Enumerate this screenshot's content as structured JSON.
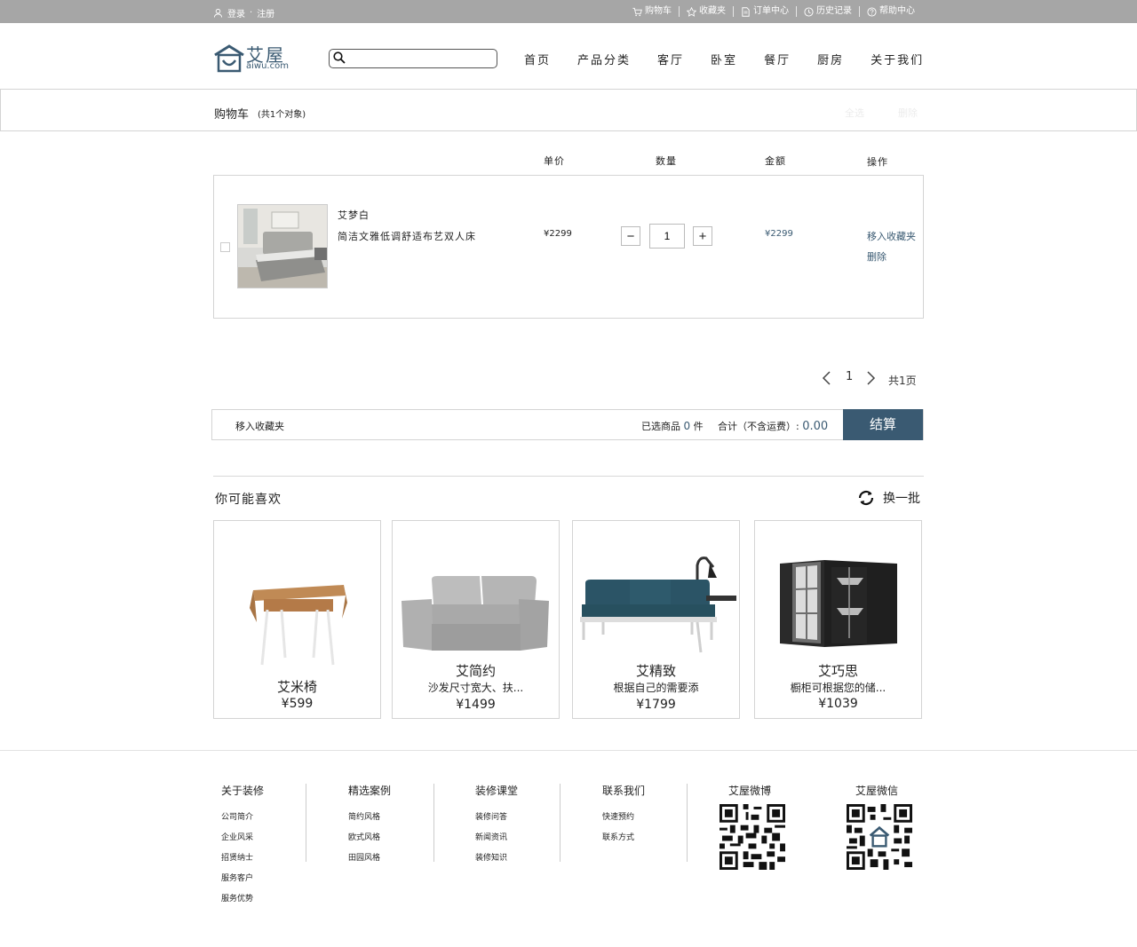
{
  "topbar": {
    "login": "登录",
    "dot": "·",
    "register": "注册",
    "items": [
      {
        "label": "购物车",
        "icon": "cart-icon"
      },
      {
        "label": "收藏夹",
        "icon": "star-icon"
      },
      {
        "label": "订单中心",
        "icon": "document-icon"
      },
      {
        "label": "历史记录",
        "icon": "clock-icon"
      },
      {
        "label": "帮助中心",
        "icon": "help-icon"
      }
    ]
  },
  "header": {
    "logo_text": "艾屋",
    "logo_sub": "aiwu.com",
    "search_placeholder": "",
    "nav": [
      "首页",
      "产品分类",
      "客厅",
      "卧室",
      "餐厅",
      "厨房",
      "关于我们"
    ]
  },
  "cart": {
    "title": "购物车",
    "count": "(共1个对象)",
    "ghost_select_all": "全选",
    "ghost_delete": "删除",
    "columns": {
      "unit_price": "单价",
      "quantity": "数量",
      "amount": "金额",
      "operation": "操作"
    },
    "item": {
      "brand": "艾梦白",
      "description": "简洁文雅低调舒适布艺双人床",
      "unit_price": "¥2299",
      "quantity": "1",
      "amount": "¥2299",
      "move_to_favorites": "移入收藏夹",
      "delete": "删除"
    },
    "pagination": {
      "current": "1",
      "total": "共1页"
    },
    "summary": {
      "move_to_favorites": "移入收藏夹",
      "selected_prefix": "已选商品",
      "selected_count": "0",
      "selected_suffix": "件",
      "total_label": "合计（不含运费）:",
      "total_value": "0.00",
      "checkout": "结算"
    }
  },
  "recommend": {
    "title": "你可能喜欢",
    "refresh": "换一批",
    "cards": [
      {
        "name": "艾米椅",
        "desc": "",
        "price": "¥599"
      },
      {
        "name": "艾简约",
        "desc": "沙发尺寸宽大、扶...",
        "price": "¥1499"
      },
      {
        "name": "艾精致",
        "desc": "根据自己的需要添",
        "price": "¥1799"
      },
      {
        "name": "艾巧思",
        "desc": "橱柜可根据您的储...",
        "price": "¥1039"
      }
    ]
  },
  "footer": {
    "columns": [
      {
        "title": "关于装修",
        "links": [
          "公司简介",
          "企业风采",
          "招贤纳士",
          "服务客户",
          "服务优势"
        ]
      },
      {
        "title": "精选案例",
        "links": [
          "简约风格",
          "欧式风格",
          "田园风格"
        ]
      },
      {
        "title": "装修课堂",
        "links": [
          "装修问答",
          "新闻资讯",
          "装修知识"
        ]
      },
      {
        "title": "联系我们",
        "links": [
          "快速预约",
          "联系方式"
        ]
      }
    ],
    "weibo": "艾屋微博",
    "wechat": "艾屋微信"
  },
  "colors": {
    "accent": "#3a5a72",
    "topbar": "#a6a6a6",
    "border": "#d4d4d4"
  }
}
